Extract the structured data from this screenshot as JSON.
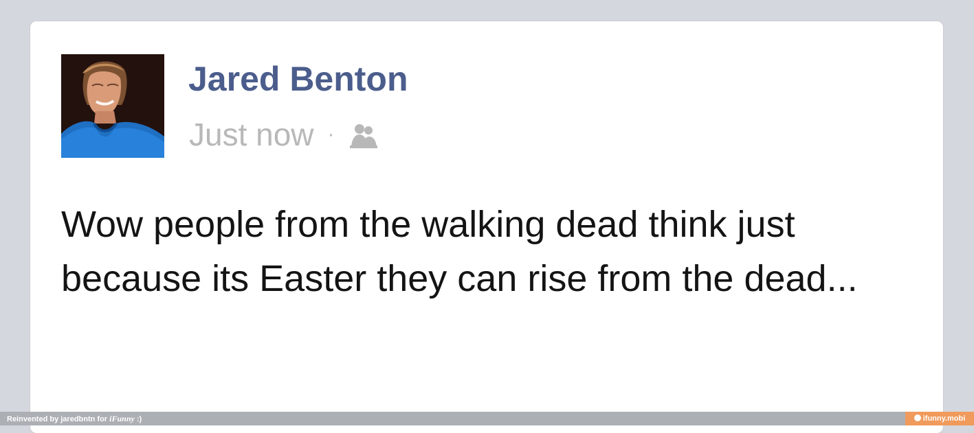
{
  "post": {
    "author_name": "Jared Benton",
    "timestamp": "Just now",
    "separator": "·",
    "audience_icon": "friends-audience-icon",
    "text": "Wow people from the walking dead think just because its Easter they can rise from the dead..."
  },
  "footer": {
    "left_text": "Reinvented by jaredbntn for ",
    "brand": "iFunny",
    "smile": " :)",
    "right_text": "ifunny.mobi"
  },
  "colors": {
    "author_name": "#4b5d8c",
    "meta_text": "#b8b8b8",
    "post_text": "#141414",
    "background": "#d4d7de",
    "footer_left": "#acafb4",
    "footer_right": "#f09a5c"
  }
}
